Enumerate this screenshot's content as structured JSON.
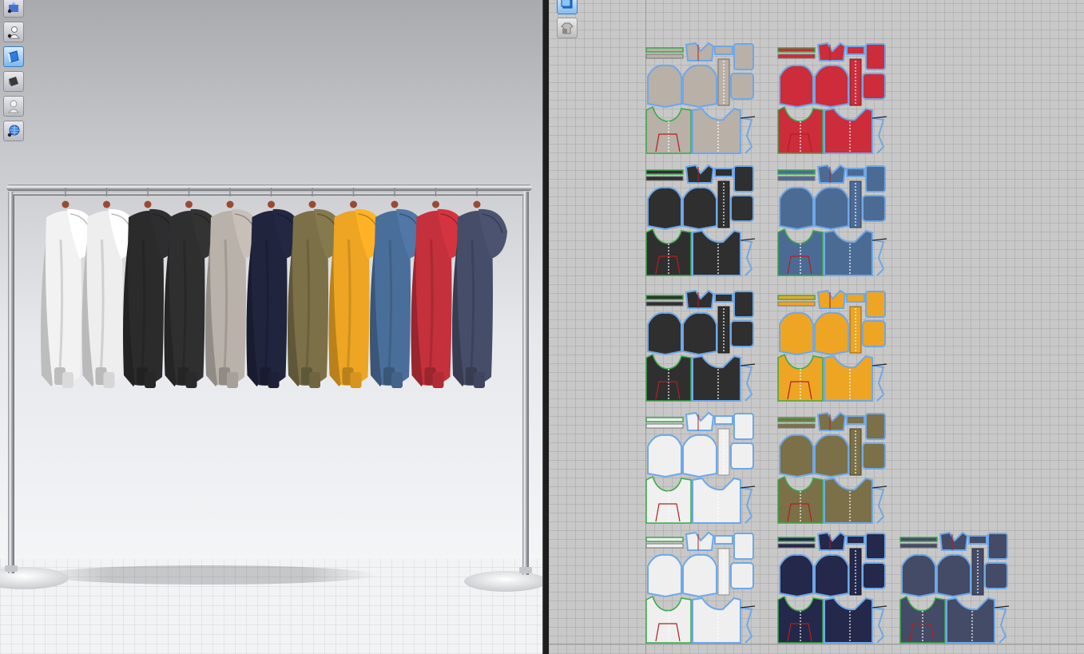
{
  "app": {
    "name": "",
    "accent": "#3a8fe0"
  },
  "viewport_3d": {
    "toolbar": [
      {
        "icon": "texture-view-icon"
      },
      {
        "icon": "avatar-display-icon"
      },
      {
        "icon": "garment-display-icon",
        "active": true
      },
      {
        "icon": "shaded-view-icon"
      },
      {
        "icon": "avatar-silhouette-icon"
      },
      {
        "icon": "wireframe-globe-icon"
      }
    ],
    "rack": {
      "material": "chrome",
      "hanger_color": "#9a4a32"
    },
    "hoodies": [
      {
        "color": "#f2f2f2",
        "name": "white"
      },
      {
        "color": "#eeeeee",
        "name": "white"
      },
      {
        "color": "#2b2b2c",
        "name": "black"
      },
      {
        "color": "#2f2f30",
        "name": "black"
      },
      {
        "color": "#b9b2aa",
        "name": "stone"
      },
      {
        "color": "#20243d",
        "name": "navy"
      },
      {
        "color": "#7b7048",
        "name": "olive"
      },
      {
        "color": "#eda523",
        "name": "yellow"
      },
      {
        "color": "#4a6e9a",
        "name": "blue"
      },
      {
        "color": "#c4303b",
        "name": "red"
      },
      {
        "color": "#464d68",
        "name": "slate"
      }
    ]
  },
  "pattern_2d": {
    "toolbar": [
      {
        "icon": "layout-select-icon",
        "active": true
      },
      {
        "icon": "garment-lock-icon"
      }
    ],
    "pattern_sets": [
      {
        "color": "#b9b0a7"
      },
      {
        "color": "#cd2c3a"
      },
      {
        "color": "#2f2f30"
      },
      {
        "color": "#4c6b94"
      },
      {
        "color": "#2f2f30"
      },
      {
        "color": "#eda523"
      },
      {
        "color": "#f0f0f0"
      },
      {
        "color": "#7b7048"
      },
      {
        "color": "#efefef"
      },
      {
        "color": "#24284a"
      },
      {
        "color": "#444b66"
      }
    ]
  }
}
